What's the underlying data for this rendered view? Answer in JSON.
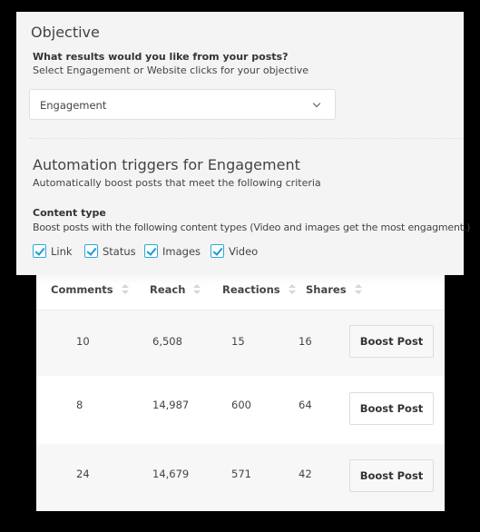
{
  "objective": {
    "title": "Objective",
    "question": "What results would you like from your posts?",
    "help": "Select Engagement or Website clicks for your objective",
    "select": {
      "value": "Engagement",
      "icon": "chevron-down-icon"
    }
  },
  "automation": {
    "title": "Automation triggers for Engagement",
    "help": "Automatically boost posts that meet the following criteria",
    "content_type": {
      "label": "Content type",
      "help": "Boost posts with the following content types (Video and images get the most engagment.)",
      "options": [
        {
          "label": "Link",
          "checked": true
        },
        {
          "label": "Status",
          "checked": true
        },
        {
          "label": "Images",
          "checked": true
        },
        {
          "label": "Video",
          "checked": true
        }
      ]
    }
  },
  "table": {
    "columns": [
      "Comments",
      "Reach",
      "Reactions",
      "Shares"
    ],
    "rows": [
      {
        "comments": "10",
        "reach": "6,508",
        "reactions": "15",
        "shares": "16",
        "action": "Boost Post"
      },
      {
        "comments": "8",
        "reach": "14,987",
        "reactions": "600",
        "shares": "64",
        "action": "Boost Post"
      },
      {
        "comments": "24",
        "reach": "14,679",
        "reactions": "571",
        "shares": "42",
        "action": "Boost Post"
      }
    ]
  },
  "colors": {
    "checkbox_accent": "#2fa8dc",
    "panel_bg": "#f4f4f4",
    "backdrop": "#000000"
  }
}
